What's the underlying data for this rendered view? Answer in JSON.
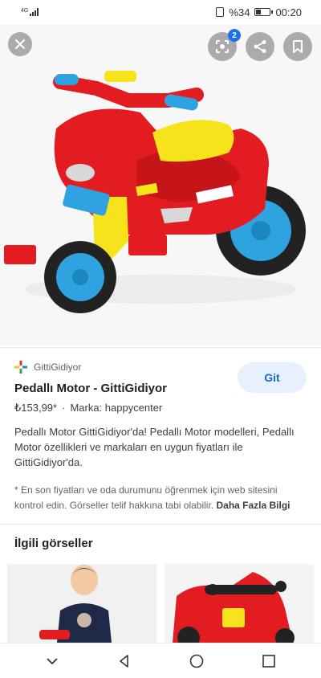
{
  "status_bar": {
    "network": "4G",
    "battery": "%34",
    "time": "00:20",
    "battery_level": 0.34
  },
  "image_viewer": {
    "lens_badge_count": "2",
    "icons": {
      "close": "close-icon",
      "lens": "lens-icon",
      "share": "share-icon",
      "save": "bookmark-icon"
    }
  },
  "result": {
    "source": "GittiGidiyor",
    "title": "Pedallı Motor - GittiGidiyor",
    "price": "₺153,99*",
    "brand": "Marka: happycenter",
    "description": "Pedallı Motor GittiGidiyor'da! Pedallı Motor modelleri, Pedallı Motor özellikleri ve markaları en uygun fiyatları ile GittiGidiyor'da.",
    "note": "* En son fiyatları ve oda durumunu öğrenmek için web sitesini kontrol edin. Görseller telif hakkına tabi olabilir.",
    "more_info": "Daha Fazla Bilgi",
    "visit_label": "Git"
  },
  "related": {
    "title": "İlgili görseller"
  },
  "colors": {
    "accent": "#1a73e8",
    "toy_red": "#e21c21",
    "toy_yellow": "#f6e31b",
    "toy_blue": "#2ea3e0"
  }
}
